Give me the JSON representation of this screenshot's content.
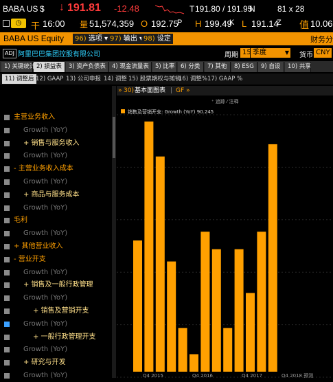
{
  "quote": {
    "ticker": "BABA US",
    "currency_sym": "$",
    "arrow": "↓",
    "last": "191.81",
    "change": "-12.48",
    "range_prefix": "T",
    "range": "191.80 / 191.95",
    "range_suffix": "N",
    "size": "81 x 28",
    "qtype": "干",
    "time": "16:00",
    "vol_prefix": "量",
    "volume": "51,574,359",
    "open_label": "O",
    "open": "192.75",
    "open_suffix": "P",
    "high_label": "H",
    "high": "199.49",
    "high_suffix": "K",
    "low_label": "L",
    "low": "191.14",
    "low_suffix": "Z",
    "val_label": "值",
    "val": "10.06"
  },
  "command_bar": {
    "security": "BABA US Equity",
    "buttons": [
      {
        "num": "96)",
        "label": "选项 ▾"
      },
      {
        "num": "97)",
        "label": "输出 ▾"
      },
      {
        "num": "98)",
        "label": "设定"
      }
    ],
    "right_label": "财务分"
  },
  "company": {
    "adj": "ADJ",
    "name": "阿里巴巴集团控股有限公司",
    "period_label": "周期",
    "period_num": "15",
    "period_value": "季度",
    "currency_label": "货币",
    "currency_value": "CNY"
  },
  "tabs": [
    "1) 关键统计",
    "2) 损益表",
    "3) 资产负债表",
    "4) 现金流量表",
    "5) 比率",
    "6) 分类",
    "7) 其他",
    "8) ESG",
    "9) 自设",
    "10) 共享"
  ],
  "subtabs": [
    "11) 调整后",
    "12) GAAP",
    "13) 公司申报",
    "14) 调整",
    "15) 股票期权与摊销",
    "16) 调整%",
    "17) GAAP %"
  ],
  "chart_header": {
    "prefix": "»",
    "num": "30)",
    "title": "基本面图表",
    "sep": "|",
    "gf": "GF »",
    "controls": "⁺ 追踪 ⁄ 注释"
  },
  "list": [
    {
      "label": "主营业务收入",
      "type": "major",
      "indent": 0,
      "checked": false
    },
    {
      "label": "Growth (YoY)",
      "type": "growth",
      "indent": 1,
      "checked": false
    },
    {
      "label": "+ 销售与服务收入",
      "type": "sub",
      "indent": 1,
      "checked": false
    },
    {
      "label": "Growth (YoY)",
      "type": "growth",
      "indent": 1,
      "checked": false
    },
    {
      "label": "- 主营业务收入成本",
      "type": "major",
      "indent": 0,
      "checked": false
    },
    {
      "label": "Growth (YoY)",
      "type": "growth",
      "indent": 1,
      "checked": false
    },
    {
      "label": "+ 商品与服务成本",
      "type": "sub",
      "indent": 1,
      "checked": false
    },
    {
      "label": "Growth (YoY)",
      "type": "growth",
      "indent": 1,
      "checked": false
    },
    {
      "label": "毛利",
      "type": "major",
      "indent": 0,
      "checked": false
    },
    {
      "label": "Growth (YoY)",
      "type": "growth",
      "indent": 1,
      "checked": false
    },
    {
      "label": "+ 其他营业收入",
      "type": "major",
      "indent": 0,
      "checked": false
    },
    {
      "label": "- 营业开支",
      "type": "major",
      "indent": 0,
      "checked": false
    },
    {
      "label": "Growth (YoY)",
      "type": "growth",
      "indent": 1,
      "checked": false
    },
    {
      "label": "+ 销售及一般行政管理",
      "type": "sub",
      "indent": 1,
      "checked": false
    },
    {
      "label": "Growth (YoY)",
      "type": "growth",
      "indent": 1,
      "checked": false
    },
    {
      "label": "+ 销售及营销开支",
      "type": "sub",
      "indent": 2,
      "checked": false
    },
    {
      "label": "Growth (YoY)",
      "type": "growth",
      "indent": 1,
      "checked": true
    },
    {
      "label": "+ 一般行政管理开支",
      "type": "sub",
      "indent": 2,
      "checked": false
    },
    {
      "label": "Growth (YoY)",
      "type": "growth",
      "indent": 1,
      "checked": false
    },
    {
      "label": "+ 研究与开发",
      "type": "sub",
      "indent": 1,
      "checked": false
    },
    {
      "label": "Growth (YoY)",
      "type": "growth",
      "indent": 1,
      "checked": false
    }
  ],
  "colors": {
    "accent": "#f29300",
    "bar": "#ffa000",
    "red": "#ff3b3b",
    "cyan": "#2fd2ff"
  },
  "chart_data": {
    "type": "bar",
    "legend": "销售及营销开支: Growth (YoY) 90.245",
    "x_tick_labels": [
      "Q4 2015",
      "Q4 2016",
      "Q4 2017",
      "Q4 2018 预测"
    ],
    "values": [
      75,
      143,
      123,
      63,
      25,
      10,
      80,
      70,
      25,
      70,
      45,
      80,
      130
    ],
    "ylim": [
      0,
      150
    ],
    "grid": true
  }
}
